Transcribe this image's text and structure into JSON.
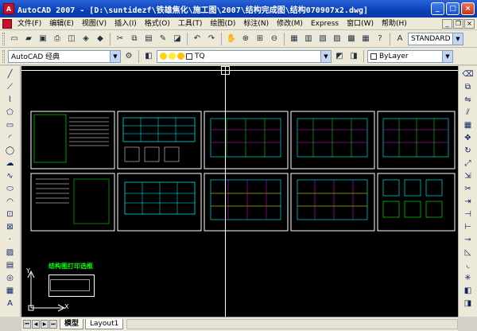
{
  "window": {
    "title": "AutoCAD 2007 - [D:\\suntidezf\\铁雄焦化\\施工图\\2007\\结构完成图\\结构070907x2.dwg]",
    "logo_letter": "A",
    "minimize": "_",
    "maximize": "□",
    "close": "×"
  },
  "menu": {
    "items": [
      "文件(F)",
      "编辑(E)",
      "视图(V)",
      "插入(I)",
      "格式(O)",
      "工具(T)",
      "绘图(D)",
      "标注(N)",
      "修改(M)",
      "Express",
      "窗口(W)",
      "帮助(H)"
    ],
    "doc_min": "_",
    "doc_restore": "❐",
    "doc_close": "×"
  },
  "toolbar": {
    "text_style": "STANDARD",
    "workspace": "AutoCAD 经典",
    "layer": "TQ",
    "linetype": "ByLayer"
  },
  "canvas": {
    "print_label": "结构图打印选框"
  },
  "ucs": {
    "x_label": "X",
    "y_label": "Y"
  },
  "tabs": {
    "model": "模型",
    "layout1": "Layout1"
  },
  "colors": {
    "titlebar": "#0a3fb8",
    "canvas_bg": "#000000",
    "drawing_cyan": "#00ffff",
    "drawing_green": "#00ff00",
    "drawing_magenta": "#ff00ff",
    "drawing_yellow": "#ffff00"
  }
}
